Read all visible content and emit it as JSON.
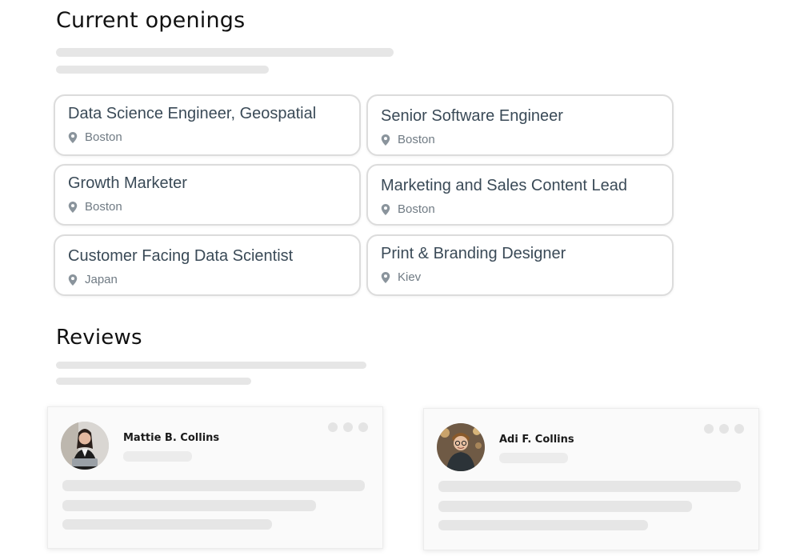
{
  "openings": {
    "title": "Current openings",
    "jobs": [
      {
        "title": "Data Science Engineer, Geospatial",
        "location": "Boston"
      },
      {
        "title": "Senior Software Engineer",
        "location": "Boston"
      },
      {
        "title": "Growth Marketer",
        "location": "Boston"
      },
      {
        "title": "Marketing and Sales Content Lead",
        "location": "Boston"
      },
      {
        "title": "Customer Facing Data Scientist",
        "location": "Japan"
      },
      {
        "title": "Print & Branding Designer",
        "location": "Kiev"
      }
    ]
  },
  "reviews": {
    "title": "Reviews",
    "items": [
      {
        "name": "Mattie B. Collins"
      },
      {
        "name": "Adi F. Collins"
      }
    ]
  },
  "icons": {
    "location": "map-pin-icon",
    "more": "more-dots-icon"
  },
  "colors": {
    "skeleton": "#e6e6e6",
    "card_border": "#dcdcdc",
    "job_title": "#3a4a57",
    "location_text": "#707b84"
  }
}
